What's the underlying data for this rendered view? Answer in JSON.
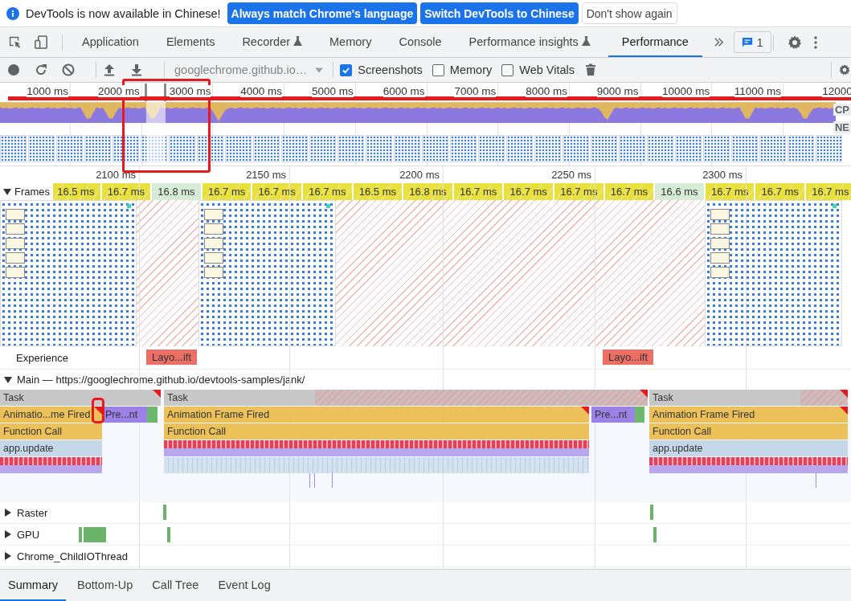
{
  "infobar": {
    "message": "DevTools is now available in Chinese!",
    "buttons": [
      {
        "label": "Always match Chrome's language",
        "kind": "primary"
      },
      {
        "label": "Switch DevTools to Chinese",
        "kind": "primary"
      },
      {
        "label": "Don't show again",
        "kind": "secondary"
      }
    ]
  },
  "tabs": [
    {
      "label": "Application",
      "selected": false,
      "experimental": false
    },
    {
      "label": "Elements",
      "selected": false,
      "experimental": false
    },
    {
      "label": "Recorder",
      "selected": false,
      "experimental": true
    },
    {
      "label": "Memory",
      "selected": false,
      "experimental": false
    },
    {
      "label": "Console",
      "selected": false,
      "experimental": false
    },
    {
      "label": "Performance insights",
      "selected": false,
      "experimental": true
    },
    {
      "label": "Performance",
      "selected": true,
      "experimental": false
    }
  ],
  "issues_count": "1",
  "toolbar": {
    "recording_target": "googlechrome.github.io…",
    "options": [
      {
        "label": "Screenshots",
        "checked": true
      },
      {
        "label": "Memory",
        "checked": false
      },
      {
        "label": "Web Vitals",
        "checked": false
      }
    ]
  },
  "overview": {
    "ticks": [
      "1000 ms",
      "2000 ms",
      "3000 ms",
      "4000 ms",
      "5000 ms",
      "6000 ms",
      "7000 ms",
      "8000 ms",
      "9000 ms",
      "10000 ms",
      "11000 ms",
      "12000"
    ],
    "track_labels": [
      "CP",
      "NE"
    ]
  },
  "ruler": [
    "2100 ms",
    "2150 ms",
    "2200 ms",
    "2250 ms",
    "2300 ms"
  ],
  "frames": {
    "label": "Frames",
    "expanded": true,
    "items": [
      {
        "duration": "16.5 ms",
        "kind": "partial"
      },
      {
        "duration": "16.7 ms",
        "kind": "partial"
      },
      {
        "duration": "16.8 ms",
        "kind": "presented"
      },
      {
        "duration": "16.7 ms",
        "kind": "partial"
      },
      {
        "duration": "16.7 ms",
        "kind": "partial"
      },
      {
        "duration": "16.7 ms",
        "kind": "partial"
      },
      {
        "duration": "16.5 ms",
        "kind": "partial"
      },
      {
        "duration": "16.8 ms",
        "kind": "partial"
      },
      {
        "duration": "16.7 ms",
        "kind": "partial"
      },
      {
        "duration": "16.7 ms",
        "kind": "partial"
      },
      {
        "duration": "16.7 ms",
        "kind": "partial"
      },
      {
        "duration": "16.7 ms",
        "kind": "partial"
      },
      {
        "duration": "16.6 ms",
        "kind": "presented"
      },
      {
        "duration": "16.7 ms",
        "kind": "partial"
      },
      {
        "duration": "16.7 ms",
        "kind": "partial"
      },
      {
        "duration": "16.7 ms",
        "kind": "partial"
      }
    ]
  },
  "experience": {
    "label": "Experience",
    "shifts": [
      "Layo...ift",
      "Layo...ift"
    ]
  },
  "main": {
    "label": "Main — https://googlechrome.github.io/devtools-samples/jank/",
    "expanded": true,
    "rows": [
      {
        "entries": [
          {
            "label": "Task",
            "kind": "task",
            "warning": true
          },
          {
            "label": "Task",
            "kind": "task",
            "warning": true
          },
          {
            "label": "Task",
            "kind": "task",
            "warning": true
          }
        ]
      },
      {
        "entries": [
          {
            "label": "Animatio...me Fired",
            "kind": "animation",
            "warning": true
          },
          {
            "label": "Pre...nt",
            "kind": "paint",
            "warning": false
          },
          {
            "kind": "composite",
            "warning": false
          },
          {
            "label": "Animation Frame Fired",
            "kind": "animation",
            "warning": true
          },
          {
            "label": "Pre...nt",
            "kind": "paint",
            "warning": false
          },
          {
            "kind": "composite",
            "warning": false
          },
          {
            "label": "Animation Frame Fired",
            "kind": "animation",
            "warning": true
          }
        ]
      },
      {
        "entries": [
          {
            "label": "Function Call",
            "kind": "animation",
            "warning": false
          },
          {
            "label": "Function Call",
            "kind": "animation",
            "warning": false
          },
          {
            "label": "Function Call",
            "kind": "animation",
            "warning": false
          }
        ]
      },
      {
        "entries": [
          {
            "label": "app.update",
            "kind": "script",
            "warning": false
          },
          {
            "kind": "bars",
            "warning": false
          },
          {
            "label": "app.update",
            "kind": "script",
            "warning": false
          }
        ]
      },
      {
        "entries": [
          {
            "kind": "bars",
            "warning": false
          },
          {
            "kind": "lightbars",
            "warning": false
          },
          {
            "kind": "bars",
            "warning": false
          }
        ]
      }
    ]
  },
  "threads": [
    {
      "label": "Raster",
      "expanded": false
    },
    {
      "label": "GPU",
      "expanded": false
    },
    {
      "label": "Chrome_ChildIOThread",
      "expanded": false
    }
  ],
  "bottom_tabs": [
    {
      "label": "Summary",
      "selected": true
    },
    {
      "label": "Bottom-Up",
      "selected": false
    },
    {
      "label": "Call Tree",
      "selected": false
    },
    {
      "label": "Event Log",
      "selected": false
    }
  ]
}
